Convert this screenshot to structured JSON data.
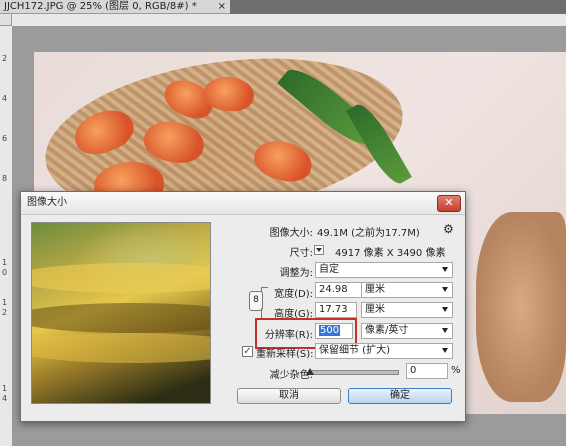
{
  "document_tab": {
    "title": "JJCH172.JPG @ 25% (图层 0, RGB/8#) *",
    "close": "×"
  },
  "ruler": {
    "left_labels": [
      "2",
      "4",
      "6",
      "8",
      "1",
      "0",
      "1",
      "2",
      "1",
      "4"
    ]
  },
  "dialog": {
    "title": "图像大小",
    "close_glyph": "✕",
    "image_size_label": "图像大小:",
    "image_size_value": "49.1M (之前为17.7M)",
    "gear_glyph": "⚙",
    "dimensions_label": "尺寸:",
    "dimensions_value": "4917 像素  X  3490 像素",
    "fit_label": "调整为:",
    "fit_value": "自定",
    "width_label": "宽度(D):",
    "width_value": "24.98",
    "width_unit": "厘米",
    "height_label": "高度(G):",
    "height_value": "17.73",
    "height_unit": "厘米",
    "resolution_label": "分辨率(R):",
    "resolution_value": "500",
    "resolution_unit": "像素/英寸",
    "resample_label": "重新采样(S):",
    "resample_checked": "✓",
    "resample_value": "保留细节 (扩大)",
    "noise_label": "减少杂色:",
    "noise_value": "0",
    "noise_unit": "%",
    "cancel_label": "取消",
    "ok_label": "确定",
    "chain_glyph": "8"
  },
  "colors": {
    "highlight": "#c4302b",
    "close_button": "#c4402c"
  }
}
